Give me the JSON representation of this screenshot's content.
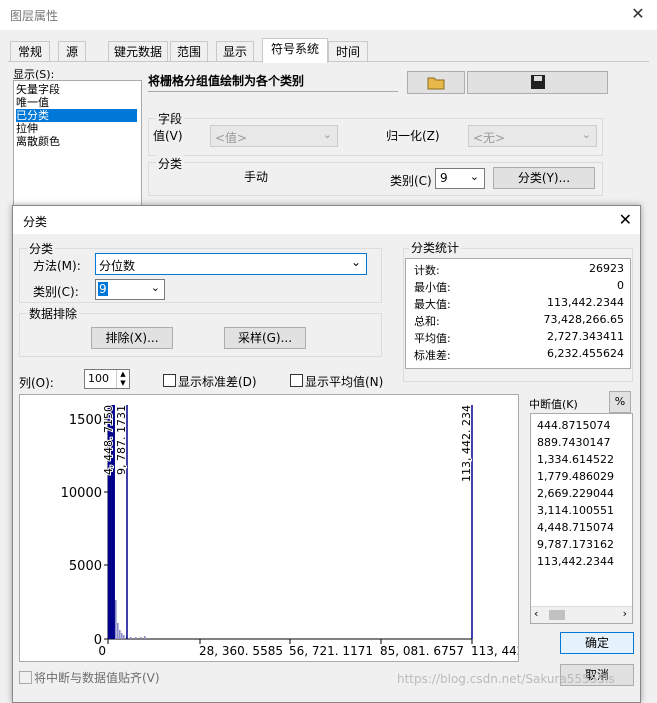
{
  "outer": {
    "title": "图层属性",
    "close": "✕",
    "tabs": [
      "常规",
      "源",
      "键元数据",
      "范围",
      "显示",
      "符号系统",
      "时间"
    ],
    "selected_tab": "符号系统",
    "show_label": "显示(S):",
    "show_items": [
      "矢量字段",
      "唯一值",
      "已分类",
      "拉伸",
      "离散颜色"
    ],
    "selected_item": "已分类",
    "heading": "将栅格分组值绘制为各个类别",
    "field_group": "字段",
    "value_label": "值(V)",
    "value_combo": "<值>",
    "normalize_label": "归一化(Z)",
    "normalize_combo": "<无>",
    "classify_group": "分类",
    "manual": "手动",
    "class_label": "类别(C)",
    "class_value": "9",
    "classify_button": "分类(Y)..."
  },
  "inner": {
    "title": "分类",
    "close": "✕",
    "classification_group": "分类",
    "method_label": "方法(M):",
    "method_value": "分位数",
    "classes_label": "类别(C):",
    "classes_value": "9",
    "exclusion_group": "数据排除",
    "exclude_button": "排除(X)...",
    "sample_button": "采样(G)...",
    "stats_group": "分类统计",
    "stats": [
      {
        "key": "计数:",
        "value": "26923"
      },
      {
        "key": "最小值:",
        "value": "0"
      },
      {
        "key": "最大值:",
        "value": "113,442.2344"
      },
      {
        "key": "总和:",
        "value": "73,428,266.65"
      },
      {
        "key": "平均值:",
        "value": "2,727.343411"
      },
      {
        "key": "标准差:",
        "value": "6,232.455624"
      }
    ],
    "columns_label": "列(O):",
    "columns_value": "100",
    "show_std": "显示标准差(D)",
    "show_mean": "显示平均值(N)",
    "breaks_label": "中断值(K)",
    "percent_button": "%",
    "breaks": [
      "444.8715074",
      "889.7430147",
      "1,334.614522",
      "1,779.486029",
      "2,669.229044",
      "3,114.100551",
      "4,448.715074",
      "9,787.173162",
      "113,442.2344"
    ],
    "ok_button": "确定",
    "cancel_button": "取消",
    "snap_label": "将中断与数据值贴齐(V)",
    "watermark": "https://blog.csdn.net/Sakura55555ls"
  },
  "chart_data": {
    "type": "histogram",
    "y_ticks": [
      "1500",
      "10000",
      "5000",
      "0"
    ],
    "x_ticks": [
      "0",
      "28, 360. 5585",
      "56, 721. 1171",
      "85, 081. 6757",
      "113, 442. 23"
    ],
    "break_labels": [
      "4, 448. 7150",
      "9, 787. 1731",
      "113, 442. 234"
    ],
    "accent_color": "#00008b"
  }
}
